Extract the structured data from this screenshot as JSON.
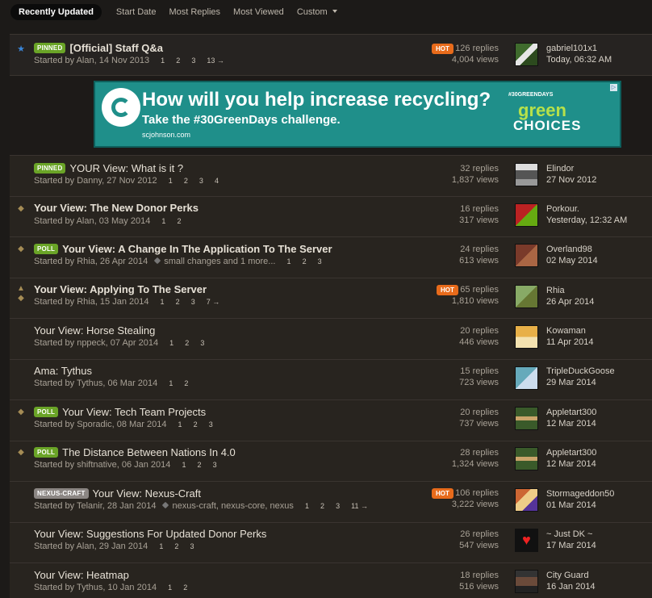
{
  "tabs": {
    "active": "Recently Updated",
    "start_date": "Start Date",
    "most_replies": "Most Replies",
    "most_viewed": "Most Viewed",
    "custom": "Custom"
  },
  "ad": {
    "headline": "How will you help increase recycling?",
    "subline": "Take the #30GreenDays challenge.",
    "url": "scjohnson.com",
    "brand_top": "#30GREENDAYS",
    "brand_green": "green",
    "brand_choices": "CHOICES"
  },
  "topics": [
    {
      "badge": "PINNED",
      "title": "[Official] Staff Q&a",
      "started": "Started by Alan, 14 Nov 2013",
      "pages": [
        "1",
        "2",
        "3",
        "13 →"
      ],
      "hot": "HOT",
      "replies": "126 replies",
      "views": "4,004 views",
      "last_user": "gabriel101x1",
      "last_time": "Today, 06:32 AM"
    },
    {
      "badge": "PINNED",
      "title": "YOUR View: What is it ?",
      "started": "Started by Danny, 27 Nov 2012",
      "pages": [
        "1",
        "2",
        "3",
        "4"
      ],
      "replies": "32 replies",
      "views": "1,837 views",
      "last_user": "Elindor",
      "last_time": "27 Nov 2012"
    },
    {
      "title": "Your View: The New Donor Perks",
      "started": "Started by Alan, 03 May 2014",
      "pages": [
        "1",
        "2"
      ],
      "replies": "16 replies",
      "views": "317 views",
      "last_user": "Porkour.",
      "last_time": "Yesterday, 12:32 AM"
    },
    {
      "badge": "POLL",
      "title": "Your View: A Change In The Application To The Server",
      "started": "Started by Rhia, 26 Apr 2014",
      "tags": "small changes and 1 more...",
      "pages": [
        "1",
        "2",
        "3"
      ],
      "replies": "24 replies",
      "views": "613 views",
      "last_user": "Overland98",
      "last_time": "02 May 2014"
    },
    {
      "title": "Your View: Applying To The Server",
      "started": "Started by Rhia, 15 Jan 2014",
      "pages": [
        "1",
        "2",
        "3",
        "7 →"
      ],
      "hot": "HOT",
      "replies": "65 replies",
      "views": "1,810 views",
      "last_user": "Rhia",
      "last_time": "26 Apr 2014"
    },
    {
      "title": "Your View: Horse Stealing",
      "started": "Started by nppeck, 07 Apr 2014",
      "pages": [
        "1",
        "2",
        "3"
      ],
      "replies": "20 replies",
      "views": "446 views",
      "last_user": "Kowaman",
      "last_time": "11 Apr 2014"
    },
    {
      "title": "Ama: Tythus",
      "started": "Started by Tythus, 06 Mar 2014",
      "pages": [
        "1",
        "2"
      ],
      "replies": "15 replies",
      "views": "723 views",
      "last_user": "TripleDuckGoose",
      "last_time": "29 Mar 2014"
    },
    {
      "badge": "POLL",
      "title": "Your View: Tech Team Projects",
      "started": "Started by Sporadic, 08 Mar 2014",
      "pages": [
        "1",
        "2",
        "3"
      ],
      "replies": "20 replies",
      "views": "737 views",
      "last_user": "Appletart300",
      "last_time": "12 Mar 2014"
    },
    {
      "badge": "POLL",
      "title": "The Distance Between Nations In 4.0",
      "started": "Started by shiftnative, 06 Jan 2014",
      "pages": [
        "1",
        "2",
        "3"
      ],
      "replies": "28 replies",
      "views": "1,324 views",
      "last_user": "Appletart300",
      "last_time": "12 Mar 2014"
    },
    {
      "badge": "NEXUS-CRAFT",
      "title": "Your View: Nexus-Craft",
      "started": "Started by Telanir, 28 Jan 2014",
      "tags": "nexus-craft, nexus-core, nexus",
      "pages": [
        "1",
        "2",
        "3",
        "11 →"
      ],
      "hot": "HOT",
      "replies": "106 replies",
      "views": "3,222 views",
      "last_user": "Stormageddon50",
      "last_time": "01 Mar 2014"
    },
    {
      "title": "Your View: Suggestions For Updated Donor Perks",
      "started": "Started by Alan, 29 Jan 2014",
      "pages": [
        "1",
        "2",
        "3"
      ],
      "replies": "26 replies",
      "views": "547 views",
      "last_user": "~ Just DK ~",
      "last_time": "17 Mar 2014"
    },
    {
      "title": "Your View: Heatmap",
      "started": "Started by Tythus, 10 Jan 2014",
      "pages": [
        "1",
        "2"
      ],
      "replies": "18 replies",
      "views": "516 views",
      "last_user": "City Guard",
      "last_time": "16 Jan 2014"
    }
  ]
}
